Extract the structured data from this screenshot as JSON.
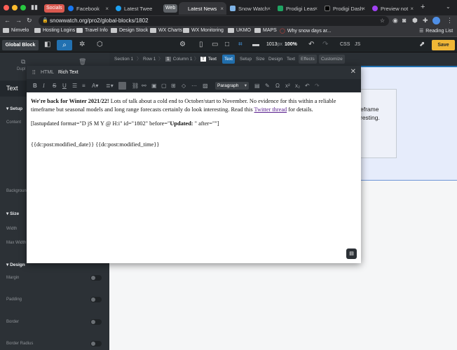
{
  "browser": {
    "tabs": [
      {
        "label": "Socials",
        "kind": "group",
        "color": "#d9584f"
      },
      {
        "label": "Facebook",
        "kind": "tab",
        "icon": "facebook-icon"
      },
      {
        "label": "Latest Twee",
        "kind": "tab",
        "icon": "twitter-icon"
      },
      {
        "label": "Web",
        "kind": "group",
        "color": "#5f6368"
      },
      {
        "label": "Latest News",
        "kind": "tab",
        "active": true
      },
      {
        "label": "Snow Watch",
        "kind": "tab",
        "icon": "snowwatch-icon"
      },
      {
        "label": "Prodigi Leas",
        "kind": "tab",
        "icon": "sheets-icon"
      },
      {
        "label": "Prodigi Dash",
        "kind": "tab",
        "icon": "prodigi-icon"
      },
      {
        "label": "Preview not",
        "kind": "tab",
        "icon": "preview-icon"
      }
    ],
    "url": "snowwatch.org/pro2/global-blocks/1802",
    "bookmarks": [
      "Nimvelo",
      "Hosting Logins",
      "Travel Info",
      "Design Stock",
      "WX Charts",
      "WX Monitoring",
      "UKMO",
      "MAPS",
      "Why snow days ar..."
    ],
    "reading_list": "Reading List"
  },
  "builder": {
    "global_block": "Global Block",
    "breakpoint_width": "1013",
    "breakpoint_unit": "px",
    "zoom": "100%",
    "css": "CSS",
    "js": "JS",
    "save": "Save",
    "breadcrumb": [
      "Section 1",
      "Row 1",
      "Column 1",
      "Text"
    ],
    "column_badge": "1",
    "text_badge": "T",
    "tabs": [
      "Text",
      "Setup",
      "Size",
      "Design",
      "Text",
      "Effects",
      "Customize"
    ]
  },
  "left_panel": {
    "dupl": "Dupl",
    "title": "Text",
    "sections": {
      "setup": "Setup",
      "content": "Content",
      "background": "Background",
      "size": "Size",
      "width": "Width",
      "max_width": "Max Width",
      "design": "Design",
      "margin": "Margin",
      "padding": "Padding",
      "border": "Border",
      "border_radius": "Border Radius"
    }
  },
  "editor": {
    "tabs": [
      "HTML",
      "Rich Text"
    ],
    "format": "Paragraph",
    "bold_lead": "We're back for Winter 2021/22!",
    "text1": " Lots of talk about a cold end to October/start to November. No evidence for this within a reliable timeframe but seasonal models and long range forecasts certainly do look interesting. Read this ",
    "link": "Twitter thread",
    "text2": " for details.",
    "shortcode_pre": "[lastupdated format=\"D jS M Y @ H:i\" id=\"1802\" before=\"",
    "shortcode_bold": "Updated:",
    "shortcode_post": " \" after=\"\"]",
    "dynamic": "{{dc:post:modified_date}} {{dc:post:modified_time}}"
  },
  "canvas": {
    "line1": "eframe",
    "line2": "resting."
  }
}
